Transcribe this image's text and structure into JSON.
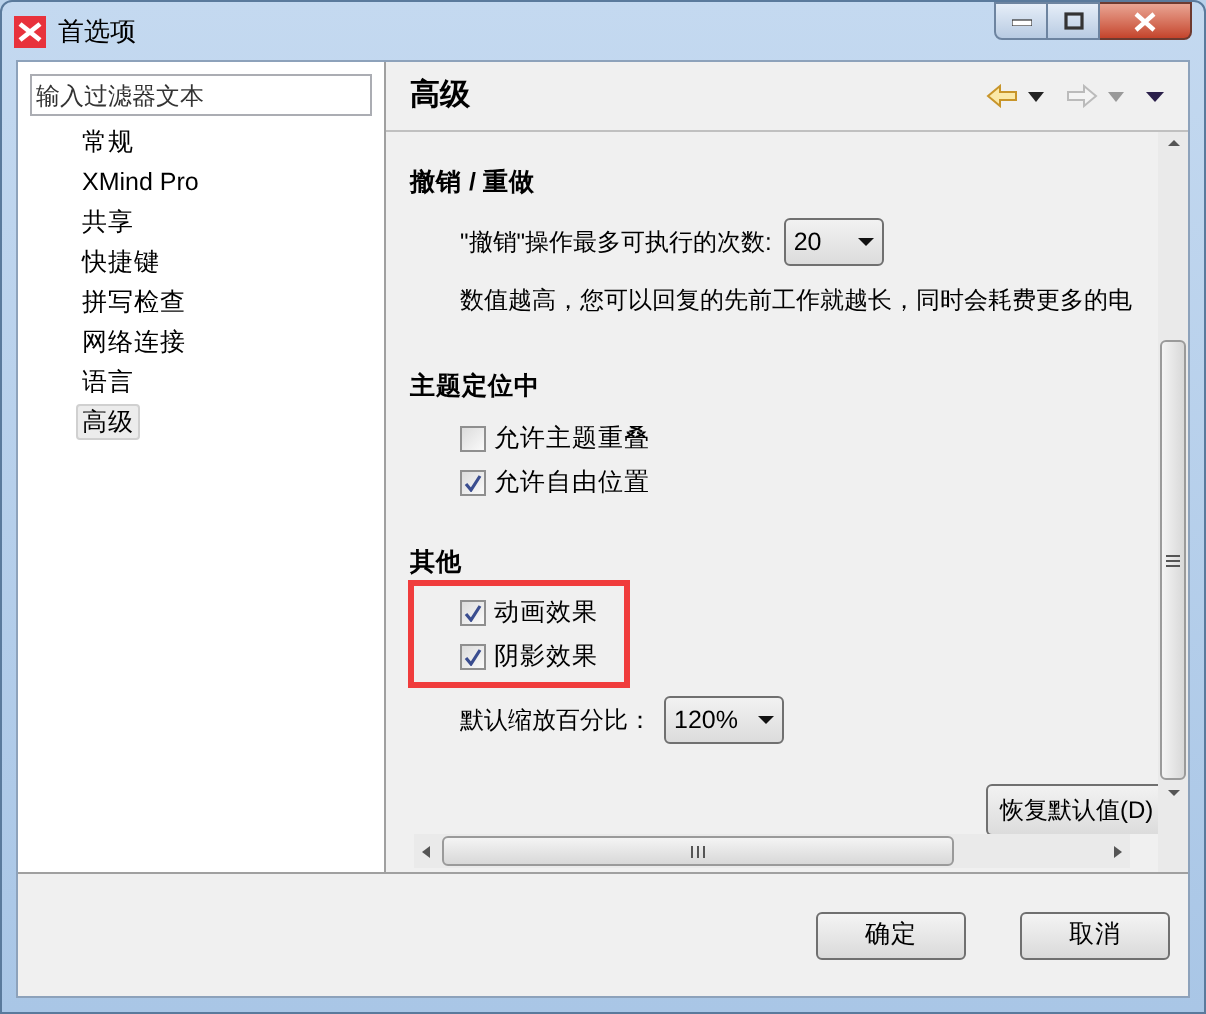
{
  "window": {
    "title": "首选项"
  },
  "filter": {
    "placeholder": "输入过滤器文本"
  },
  "nav": [
    {
      "label": "常规",
      "selected": false
    },
    {
      "label": "XMind Pro",
      "selected": false
    },
    {
      "label": "共享",
      "selected": false
    },
    {
      "label": "快捷键",
      "selected": false
    },
    {
      "label": "拼写检查",
      "selected": false
    },
    {
      "label": "网络连接",
      "selected": false
    },
    {
      "label": "语言",
      "selected": false
    },
    {
      "label": "高级",
      "selected": true
    }
  ],
  "page_title": "高级",
  "sections": [
    {
      "title": "撤销 / 重做",
      "highlighted": false,
      "items": [
        {
          "kind": "combo",
          "label": "\"撤销\"操作最多可执行的次数:",
          "value": "20"
        },
        {
          "kind": "note",
          "text": "数值越高，您可以回复的先前工作就越长，同时会耗费更多的电"
        }
      ]
    },
    {
      "title": "主题定位中",
      "highlighted": false,
      "items": [
        {
          "kind": "checkbox",
          "label": "允许主题重叠",
          "checked": false
        },
        {
          "kind": "checkbox",
          "label": "允许自由位置",
          "checked": true
        }
      ]
    },
    {
      "title": "其他",
      "highlighted": true,
      "items": [
        {
          "kind": "checkbox",
          "label": "动画效果",
          "checked": true
        },
        {
          "kind": "checkbox",
          "label": "阴影效果",
          "checked": true
        },
        {
          "kind": "combo",
          "label": "默认缩放百分比：",
          "value": "120%"
        }
      ]
    }
  ],
  "restore_button": "恢复默认值(D)",
  "buttons": [
    "确定",
    "取消"
  ]
}
